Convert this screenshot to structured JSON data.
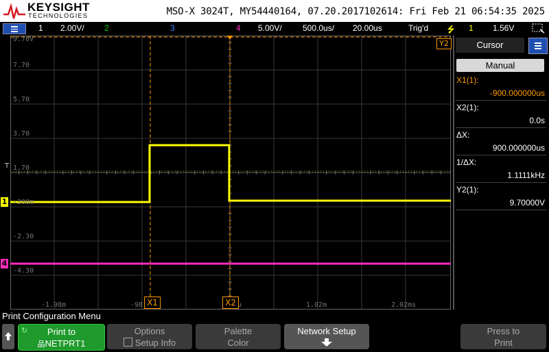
{
  "header": {
    "brand": "KEYSIGHT",
    "brand_sub": "TECHNOLOGIES",
    "instrument_info": "MSO-X 3024T, MY54440164, 07.20.2017102614: Fri Feb 21 06:54:35 2025"
  },
  "status": {
    "ch1": "1",
    "ch1_scale": "2.00V/",
    "ch2": "2",
    "ch3": "3",
    "ch4": "4",
    "ch4_scale": "5.00V/",
    "timebase": "500.0us/",
    "delay": "20.00us",
    "trig_state": "Trig'd",
    "trig_source": "1",
    "trig_level": "1.56V"
  },
  "colors": {
    "ch1": "#ffff00",
    "ch2": "#00cc00",
    "ch3": "#3f7fff",
    "ch4": "#ff2dbd",
    "cursor": "#ff9900",
    "panel_accent": "#1f4fb2"
  },
  "screen": {
    "y_labels": [
      "9.70V",
      "7.70",
      "5.70",
      "3.70",
      "1.70",
      "-300m",
      "-2.30",
      "-4.30"
    ],
    "x_labels": [
      "-1.98m",
      "-98",
      "u",
      "1.02m",
      "2.02ms"
    ],
    "marker_x1": "X1",
    "marker_x2": "X2",
    "marker_y2": "Y2",
    "marker_t": "T",
    "ch1_marker": "1",
    "ch4_marker": "4"
  },
  "cursor_panel": {
    "title": "Cursor",
    "mode": "Manual",
    "x1_label": "X1(1):",
    "x1_value": "-900.000000us",
    "x2_label": "X2(1):",
    "x2_value": "0.0s",
    "dx_label": "ΔX:",
    "dx_value": "900.000000us",
    "inv_dx_label": "1/ΔX:",
    "inv_dx_value": "1.1111kHz",
    "y2_label": "Y2(1):",
    "y2_value": "9.70000V"
  },
  "softkeys": {
    "menu_title": "Print Configuration Menu",
    "print_to_l1": "Print to",
    "print_to_l2": "NETPRT1",
    "options_l1": "Options",
    "options_l2": "Setup Info",
    "palette_l1": "Palette",
    "palette_l2": "Color",
    "network_setup": "Network Setup",
    "press_l1": "Press to",
    "press_l2": "Print"
  }
}
